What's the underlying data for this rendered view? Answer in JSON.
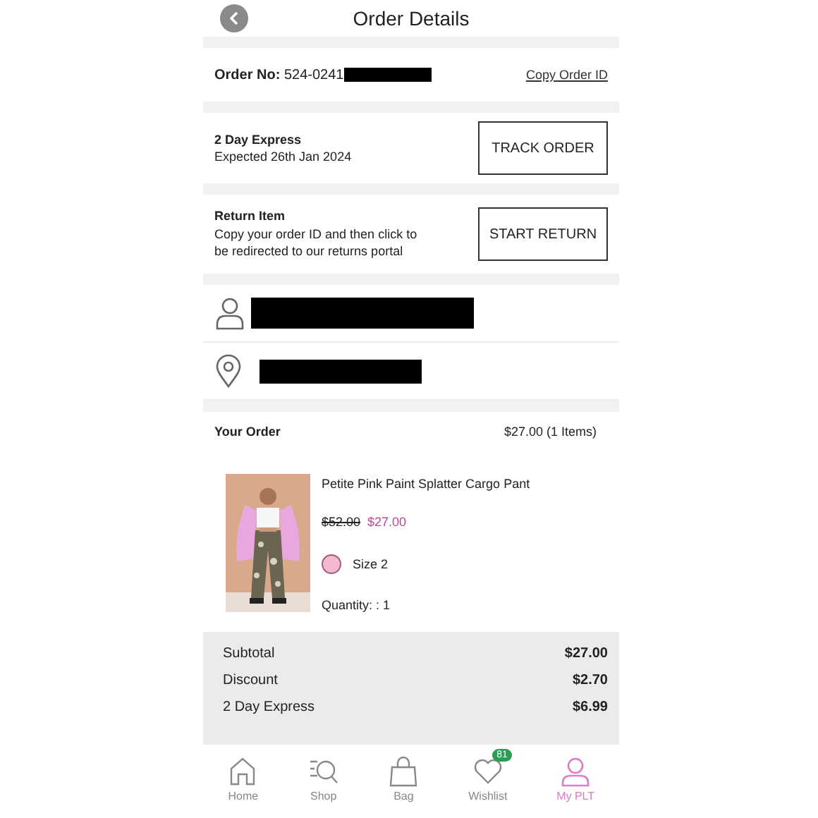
{
  "header": {
    "title": "Order Details"
  },
  "order": {
    "label": "Order No:",
    "number": "524-0241",
    "copy_link": "Copy Order ID"
  },
  "delivery": {
    "title": "2 Day Express",
    "expected": "Expected 26th Jan 2024",
    "button": "TRACK ORDER"
  },
  "return": {
    "title": "Return Item",
    "text": "Copy your order ID and then click to be redirected to our returns portal",
    "button": "START RETURN"
  },
  "your_order": {
    "title": "Your Order",
    "total": "$27.00 (1 Items)"
  },
  "item": {
    "name": "Petite Pink Paint Splatter Cargo Pant",
    "old_price": "$52.00",
    "price": "$27.00",
    "size": "Size 2",
    "quantity": "Quantity: : 1"
  },
  "summary": [
    {
      "label": "Subtotal",
      "value": "$27.00"
    },
    {
      "label": "Discount",
      "value": "$2.70"
    },
    {
      "label": "2 Day Express",
      "value": "$6.99"
    }
  ],
  "tab_bar": [
    {
      "label": "Home",
      "kind": "home",
      "selected": false
    },
    {
      "label": "Shop",
      "kind": "shop",
      "selected": false
    },
    {
      "label": "Bag",
      "kind": "bag",
      "selected": false
    },
    {
      "label": "Wishlist",
      "kind": "wishlist",
      "selected": false,
      "badge": "81"
    },
    {
      "label": "My PLT",
      "kind": "account",
      "selected": true
    }
  ]
}
